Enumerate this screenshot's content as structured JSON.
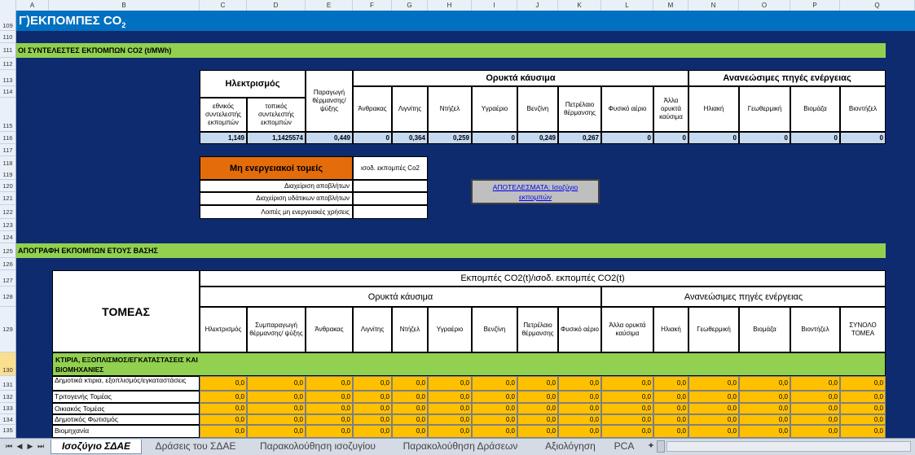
{
  "column_headers": [
    "A",
    "B",
    "C",
    "D",
    "E",
    "F",
    "G",
    "H",
    "I",
    "J",
    "K",
    "L",
    "M",
    "N",
    "O",
    "P",
    "Q"
  ],
  "row_numbers": {
    "r109": "109",
    "r110": "110",
    "r111": "111",
    "r112": "112",
    "r113": "113",
    "r114": "114",
    "r115": "115",
    "r116": "116",
    "r117": "117",
    "r118": "118",
    "r119": "119",
    "r120": "120",
    "r121": "121",
    "r122": "122",
    "r123": "123",
    "r124": "124",
    "r125": "125",
    "r126": "126",
    "r127": "127",
    "r128": "128",
    "r129": "129",
    "r130": "130",
    "r131": "131",
    "r132": "132",
    "r133": "133",
    "r134": "134",
    "r135": "135"
  },
  "title": "Γ)ΕΚΠΟΜΠΕΣ  CO",
  "title_sub": "2",
  "factors_band": "ΟΙ ΣΥΝΤΕΛΕΣΤΕΣ ΕΚΠΟΜΠΩΝ CO2 (t/MWh)",
  "factors": {
    "electricity": "Ηλεκτρισμός",
    "national": "εθνικός συντελεστής εκπομπών",
    "local": "τοπικός συντελεστής εκπομπών",
    "chp": "Παραγωγή θέρμανσης/ ψύξης",
    "fossil": "Ορυκτά κάυσιμα",
    "renew": "Ανανεώσιμες πηγές ενέργειας",
    "fuels": [
      "Άνθρακας",
      "Λιγνίτης",
      "Ντήζελ",
      "Υγραέριο",
      "Βενζίνη",
      "Πετρέλαιο θέρμανσης",
      "Φυσικό αέριο",
      "Άλλα ορυκτά καύσιμα"
    ],
    "renews": [
      "Ηλιακή",
      "Γεωθερμική",
      "Βιομάζα",
      "Βιοντήζελ"
    ],
    "values": [
      "1,149",
      "1,1425574",
      "0,449",
      "0",
      "0,364",
      "0,259",
      "0",
      "0,249",
      "0,267",
      "0",
      "0",
      "0",
      "0",
      "0",
      "0"
    ]
  },
  "nonenergy": {
    "header": "Μη ενεργειακοί τομείς",
    "eq_header": "ισοδ. εκπομπές Co2",
    "rows": [
      "Διαχείριση αποβλήτων",
      "Διαχείριση υδάτικων αποβλήτων",
      "Λοιπές μη ενεργειακές χρήσεις"
    ]
  },
  "results_link": "ΑΠΟΤΕΛΕΣΜΑΤΑ: Ισοζύγιο εκπομπών",
  "inventory_band": "ΑΠΟΓΡΑΦΗ ΕΚΠΟΜΠΩΝ ΕΤΟΥΣ ΒΑΣΗΣ",
  "inventory": {
    "sector": "ΤΟΜΕΑΣ",
    "emissions": "Εκπομπές CO2(t)/ισοδ. εκπομπές CO2(t)",
    "fossil": "Ορυκτά κάυσιμα",
    "renew": "Ανανεώσιμες πηγές ενέργειας",
    "cols": [
      "Ηλεκτρισμός",
      "Συμπαραγωγή θέρμανσης/ ψύξης",
      "Άνθρακας",
      "Λιγνίτης",
      "Ντήζελ",
      "Υγραέριο",
      "Βενζίνη",
      "Πετρέλαιο θέρμανσης",
      "Φυσικό αέριο",
      "Άλλα ορυκτά καύσιμα",
      "Ηλιακή",
      "Γεωθερμική",
      "Βιομάζα",
      "Βιοντήζελ",
      "ΣΥΝΟΛΟ ΤΟΜΕΑ"
    ],
    "group_label": "ΚΤΙΡΙΑ, ΕΞΟΠΛΙΣΜΟΣ/ΕΓΚΑΤΑΣΤΑΣΕΙΣ ΚΑΙ ΒΙΟΜΗΧΑΝΙΕΣ",
    "rows": [
      "Δημοτικά κτιρια, εξοπλισμός/εγκαταστάσεις",
      "Τριτογενής Τομέας",
      "Οικιακός Τομέας",
      "Δημοτικός Φωτισμός",
      "Βιομηχανία"
    ],
    "zero": "0,0"
  },
  "tabs": [
    "Ισοζύγιο ΣΔΑΕ",
    "Δράσεις του ΣΔΑΕ",
    "Παρακολούθηση ισοζυγίου",
    "Παρακολούθηση Δράσεων",
    "Αξιολόγηση",
    "PCA"
  ]
}
